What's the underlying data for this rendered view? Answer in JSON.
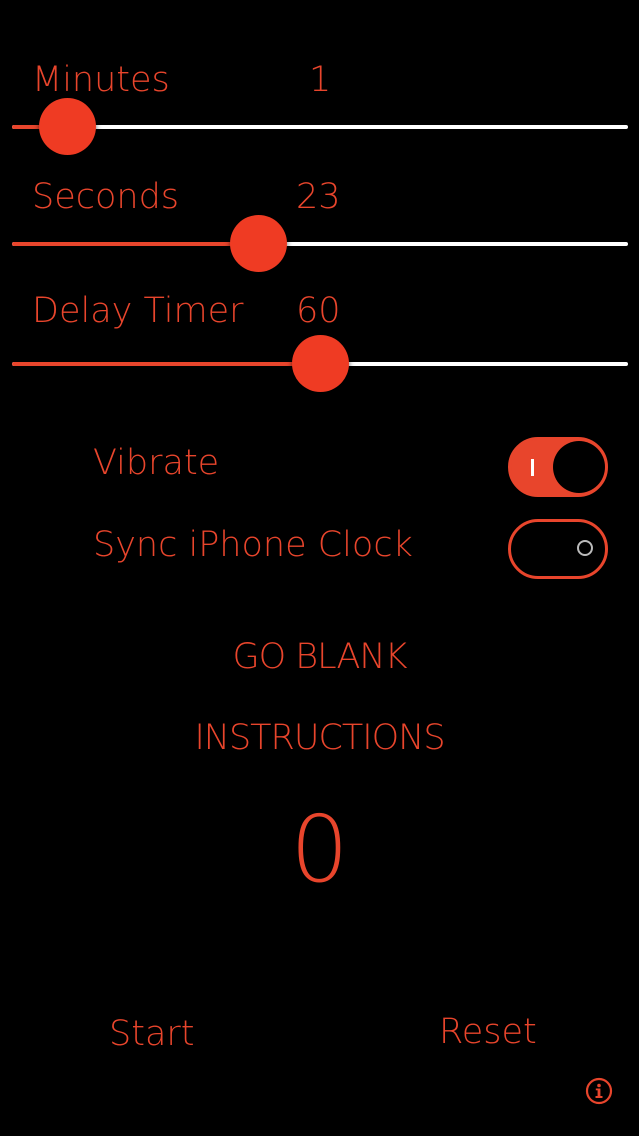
{
  "colors": {
    "accent": "#e8452c",
    "background": "#000000",
    "track": "#ffffff"
  },
  "sliders": {
    "minutes": {
      "label": "Minutes",
      "value": "1",
      "fraction": 0.09
    },
    "seconds": {
      "label": "Seconds",
      "value": "23",
      "fraction": 0.4
    },
    "delay": {
      "label": "Delay Timer",
      "value": "60",
      "fraction": 0.5
    }
  },
  "toggles": {
    "vibrate": {
      "label": "Vibrate",
      "on": true
    },
    "sync": {
      "label": "Sync iPhone Clock",
      "on": false
    }
  },
  "buttons": {
    "go_blank": "GO BLANK",
    "instructions": "INSTRUCTIONS",
    "start": "Start",
    "reset": "Reset"
  },
  "counter": "0",
  "icons": {
    "info": "info-icon"
  }
}
